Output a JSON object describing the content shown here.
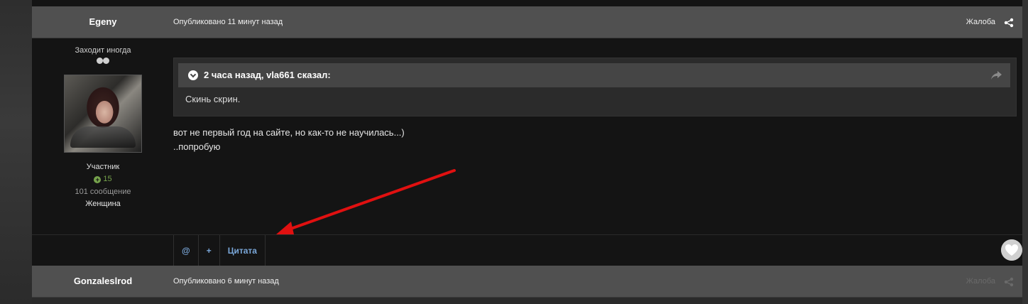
{
  "post1": {
    "author": "Egeny",
    "date": "Опубликовано 11 минут назад",
    "report": "Жалоба",
    "share_icon": "share-icon",
    "online_status": "Заходит иногда",
    "group": "Участник",
    "reputation": "15",
    "posts_count": "101 сообщение",
    "gender": "Женщина",
    "quote": {
      "citation": "2 часа назад, vla661 сказал:",
      "text": "Скинь скрин."
    },
    "message_line1": "вот не первый год на сайте, но  как-то не научилась...)",
    "message_line2": "..попробую",
    "tools": {
      "mention": "@",
      "multiquote": "+",
      "quote": "Цитата"
    }
  },
  "post2": {
    "author": "Gonzaleslrod",
    "date": "Опубликовано 6 минут назад",
    "report": "Жалоба"
  },
  "colors": {
    "accent_link": "#7aa7d9",
    "reputation": "#76a34c",
    "annotation_arrow": "#e01010"
  }
}
